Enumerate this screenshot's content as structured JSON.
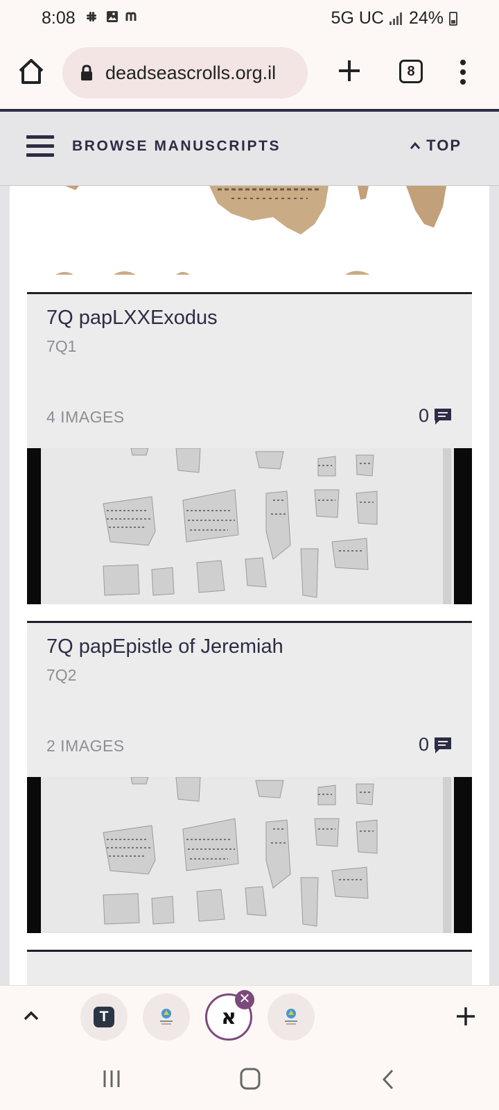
{
  "status_bar": {
    "time": "8:08",
    "notifications": [
      "slack-icon",
      "image-icon",
      "m-icon"
    ],
    "network": "5G UC",
    "battery": "24%"
  },
  "browser": {
    "url": "deadseascrolls.org.il",
    "tab_count": "8"
  },
  "site_header": {
    "title": "BROWSE MANUSCRIPTS",
    "top_label": "TOP"
  },
  "cards": [
    {
      "title": "7Q papLXXExodus",
      "id": "7Q1",
      "images_label": "4 IMAGES",
      "comments": "0"
    },
    {
      "title": "7Q papEpistle of Jeremiah",
      "id": "7Q2",
      "images_label": "2 IMAGES",
      "comments": "0"
    }
  ],
  "tab_strip": {
    "tabs": [
      "T",
      "christian-forums-favicon",
      "aleph-favicon",
      "christian-forums-favicon"
    ],
    "active_tab_letter": "א"
  },
  "colors": {
    "accent": "#7b4a7b",
    "header_text": "#2c2c44",
    "card_bg": "#ececed"
  }
}
